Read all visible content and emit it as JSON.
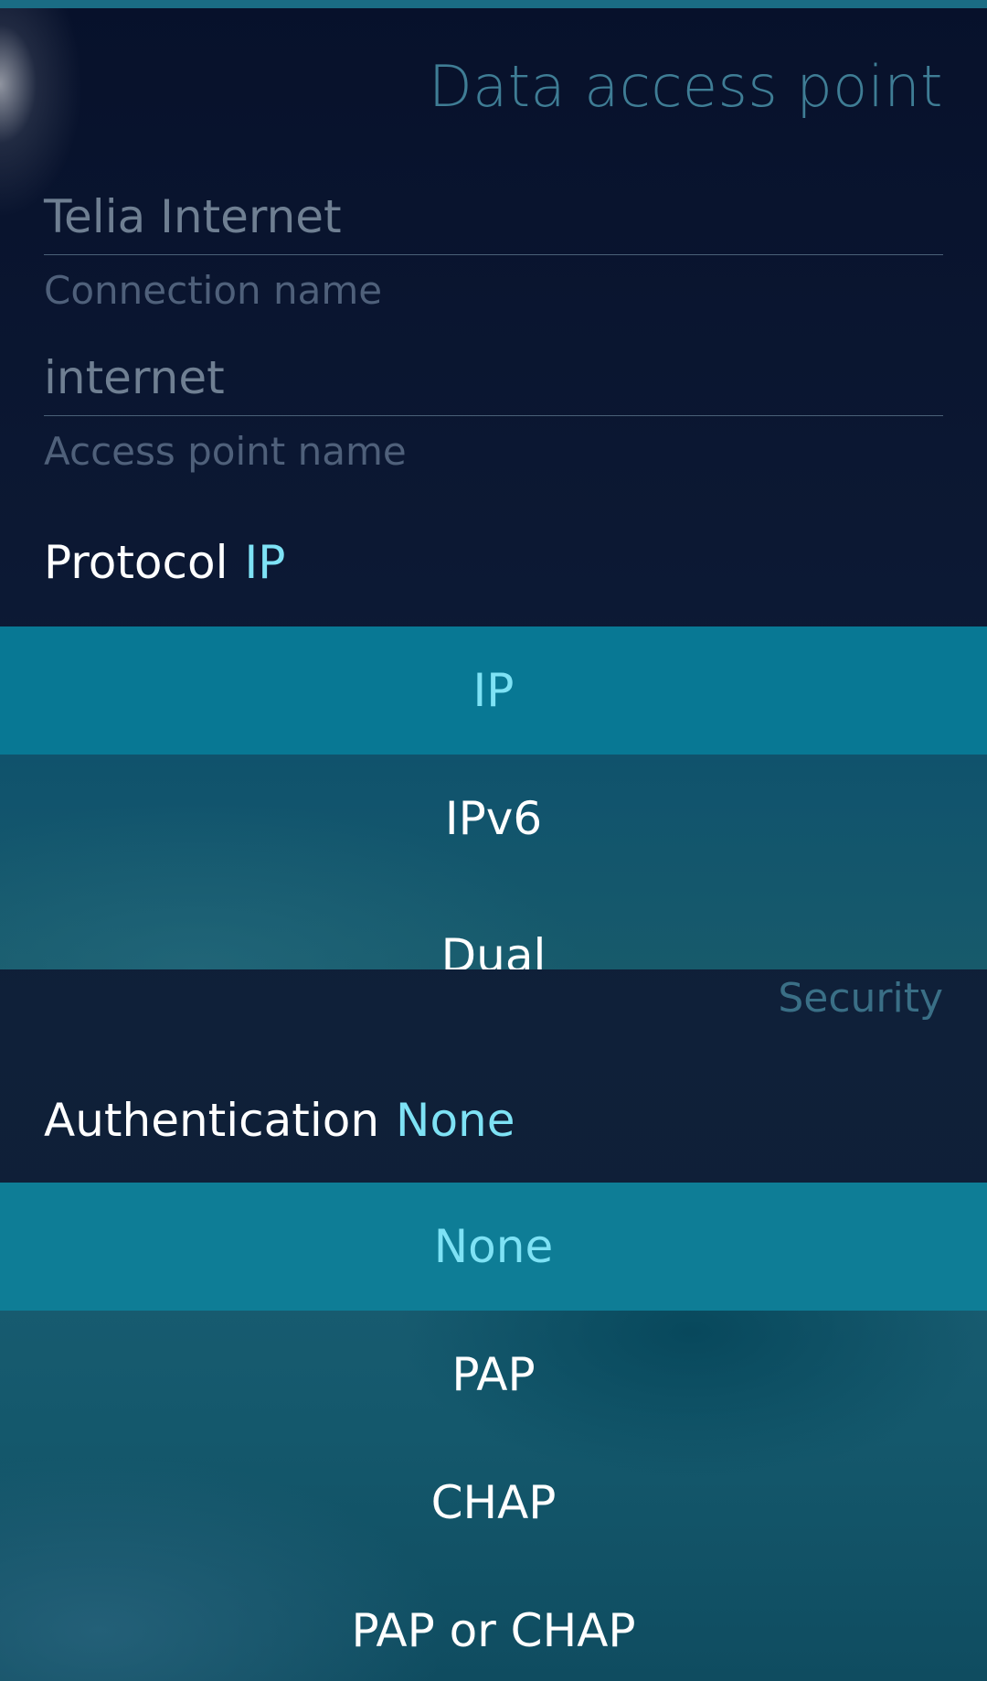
{
  "header": {
    "title": "Data access point"
  },
  "connection_name": {
    "value": "Telia Internet",
    "label": "Connection name"
  },
  "access_point_name": {
    "value": "internet",
    "label": "Access point name"
  },
  "protocol": {
    "label": "Protocol",
    "value": "IP",
    "options": [
      "IP",
      "IPv6",
      "Dual"
    ]
  },
  "security": {
    "section_label": "Security"
  },
  "authentication": {
    "label": "Authentication",
    "value": "None",
    "options": [
      "None",
      "PAP",
      "CHAP",
      "PAP or CHAP"
    ]
  },
  "colors": {
    "accent": "#7ee2f5",
    "highlight": "#0a7390",
    "background": "#0b1730"
  }
}
